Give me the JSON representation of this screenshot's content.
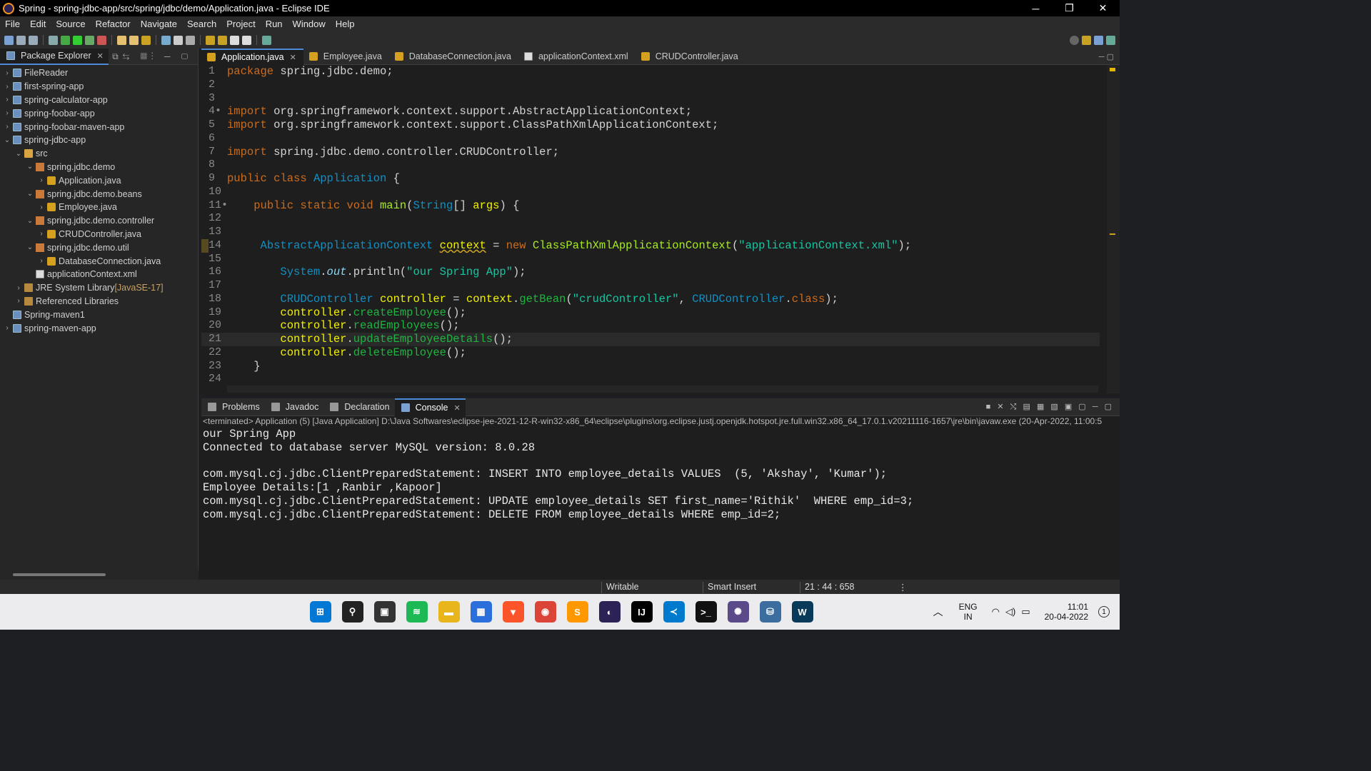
{
  "window": {
    "title": "Spring - spring-jdbc-app/src/spring/jdbc/demo/Application.java - Eclipse IDE",
    "minimize": "─",
    "restore": "❐",
    "close": "✕"
  },
  "menu": [
    "File",
    "Edit",
    "Source",
    "Refactor",
    "Navigate",
    "Search",
    "Project",
    "Run",
    "Window",
    "Help"
  ],
  "package_explorer": {
    "title": "Package Explorer",
    "items": [
      {
        "label": "FileReader",
        "icon": "project-icon",
        "indent": 0,
        "chevron": "›"
      },
      {
        "label": "first-spring-app",
        "icon": "project-icon",
        "indent": 0,
        "chevron": "›"
      },
      {
        "label": "spring-calculator-app",
        "icon": "project-icon",
        "indent": 0,
        "chevron": "›"
      },
      {
        "label": "spring-foobar-app",
        "icon": "project-icon",
        "indent": 0,
        "chevron": "›"
      },
      {
        "label": "spring-foobar-maven-app",
        "icon": "project-icon",
        "indent": 0,
        "chevron": "›"
      },
      {
        "label": "spring-jdbc-app",
        "icon": "project-icon",
        "indent": 0,
        "chevron": "⌄"
      },
      {
        "label": "src",
        "icon": "folder-icon",
        "indent": 1,
        "chevron": "⌄"
      },
      {
        "label": "spring.jdbc.demo",
        "icon": "package-icon",
        "indent": 2,
        "chevron": "⌄"
      },
      {
        "label": "Application.java",
        "icon": "java-file-icon",
        "indent": 3,
        "chevron": "›"
      },
      {
        "label": "spring.jdbc.demo.beans",
        "icon": "package-icon",
        "indent": 2,
        "chevron": "⌄"
      },
      {
        "label": "Employee.java",
        "icon": "java-file-icon",
        "indent": 3,
        "chevron": "›"
      },
      {
        "label": "spring.jdbc.demo.controller",
        "icon": "package-icon",
        "indent": 2,
        "chevron": "⌄"
      },
      {
        "label": "CRUDController.java",
        "icon": "java-file-icon",
        "indent": 3,
        "chevron": "›"
      },
      {
        "label": "spring.jdbc.demo.util",
        "icon": "package-icon",
        "indent": 2,
        "chevron": "⌄"
      },
      {
        "label": "DatabaseConnection.java",
        "icon": "java-file-icon",
        "indent": 3,
        "chevron": "›"
      },
      {
        "label": "applicationContext.xml",
        "icon": "xml-file-icon",
        "indent": 2,
        "chevron": ""
      },
      {
        "label": "JRE System Library",
        "suffix": "[JavaSE-17]",
        "icon": "library-icon",
        "indent": 1,
        "chevron": "›"
      },
      {
        "label": "Referenced Libraries",
        "icon": "library-icon",
        "indent": 1,
        "chevron": "›"
      },
      {
        "label": "Spring-maven1",
        "icon": "project-icon",
        "indent": 0,
        "chevron": ""
      },
      {
        "label": "spring-maven-app",
        "icon": "project-icon",
        "indent": 0,
        "chevron": "›"
      }
    ]
  },
  "editor_tabs": [
    {
      "label": "Application.java",
      "active": true
    },
    {
      "label": "Employee.java",
      "active": false
    },
    {
      "label": "DatabaseConnection.java",
      "active": false
    },
    {
      "label": "applicationContext.xml",
      "active": false
    },
    {
      "label": "CRUDController.java",
      "active": false
    }
  ],
  "code_lines": [
    {
      "n": "1",
      "html": "<span class='kw'>package</span> spring.jdbc.demo;"
    },
    {
      "n": "2",
      "html": ""
    },
    {
      "n": "3",
      "html": ""
    },
    {
      "n": "4",
      "html": "<span class='kw'>import</span> org.springframework.context.support.AbstractApplicationContext;",
      "marker": "•"
    },
    {
      "n": "5",
      "html": "<span class='kw'>import</span> org.springframework.context.support.ClassPathXmlApplicationContext;"
    },
    {
      "n": "6",
      "html": ""
    },
    {
      "n": "7",
      "html": "<span class='kw'>import</span> spring.jdbc.demo.controller.CRUDController;"
    },
    {
      "n": "8",
      "html": ""
    },
    {
      "n": "9",
      "html": "<span class='kw'>public</span> <span class='kw'>class</span> <span class='ty'>Application</span> {"
    },
    {
      "n": "10",
      "html": ""
    },
    {
      "n": "11",
      "html": "    <span class='kw'>public</span> <span class='kw'>static</span> <span class='kw'>void</span> <span class='fn'>main</span>(<span class='ty'>String</span>[] <span class='vr'>args</span>) {",
      "marker": "•"
    },
    {
      "n": "12",
      "html": ""
    },
    {
      "n": "13",
      "html": ""
    },
    {
      "n": "14",
      "html": "     <span class='ty'>AbstractApplicationContext</span> <span class='vr un'>context</span> = <span class='kw'>new</span> <span class='fn'>ClassPathXmlApplicationContext</span>(<span class='st'>\"applicationContext.xml\"</span>);",
      "warn": true
    },
    {
      "n": "15",
      "html": ""
    },
    {
      "n": "16",
      "html": "        <span class='ty'>System</span>.<span class='fld'>out</span>.println(<span class='st'>\"our Spring App\"</span>);"
    },
    {
      "n": "17",
      "html": ""
    },
    {
      "n": "18",
      "html": "        <span class='ty'>CRUDController</span> <span class='vr'>controller</span> = <span class='vr'>context</span>.<span class='mth'>getBean</span>(<span class='st'>\"crudController\"</span>, <span class='ty'>CRUDController</span>.<span class='kw'>class</span>);"
    },
    {
      "n": "19",
      "html": "        <span class='vr'>controller</span>.<span class='mth'>createEmployee</span>();"
    },
    {
      "n": "20",
      "html": "        <span class='vr'>controller</span>.<span class='mth'>readEmployees</span>();"
    },
    {
      "n": "21",
      "html": "        <span class='vr'>controller</span>.<span class='mth'>updateEmployeeDetails</span>();",
      "highlight": true
    },
    {
      "n": "22",
      "html": "        <span class='vr'>controller</span>.<span class='mth'>deleteEmployee</span>();"
    },
    {
      "n": "23",
      "html": "    }"
    },
    {
      "n": "24",
      "html": ""
    }
  ],
  "console": {
    "tabs": [
      {
        "label": "Problems",
        "icon": "problems-icon"
      },
      {
        "label": "Javadoc",
        "icon": "javadoc-icon"
      },
      {
        "label": "Declaration",
        "icon": "declaration-icon"
      },
      {
        "label": "Console",
        "icon": "console-icon",
        "active": true
      }
    ],
    "info": "<terminated> Application (5) [Java Application] D:\\Java Softwares\\eclipse-jee-2021-12-R-win32-x86_64\\eclipse\\plugins\\org.eclipse.justj.openjdk.hotspot.jre.full.win32.x86_64_17.0.1.v20211116-1657\\jre\\bin\\javaw.exe  (20-Apr-2022, 11:00:5",
    "output": [
      "our Spring App",
      "Connected to database server MySQL version: 8.0.28",
      "",
      "com.mysql.cj.jdbc.ClientPreparedStatement: INSERT INTO employee_details VALUES  (5, 'Akshay', 'Kumar');",
      "Employee Details:[1 ,Ranbir ,Kapoor]",
      "com.mysql.cj.jdbc.ClientPreparedStatement: UPDATE employee_details SET first_name='Rithik'  WHERE emp_id=3;",
      "com.mysql.cj.jdbc.ClientPreparedStatement: DELETE FROM employee_details WHERE emp_id=2;"
    ]
  },
  "status": {
    "writable": "Writable",
    "insert_mode": "Smart Insert",
    "position": "21 : 44 : 658",
    "more": "⋮"
  },
  "taskbar": {
    "apps": [
      {
        "name": "windows-start-icon",
        "glyph": "⊞",
        "color": "#0078d4"
      },
      {
        "name": "search-icon",
        "glyph": "⚲",
        "color": "#222"
      },
      {
        "name": "task-view-icon",
        "glyph": "▣",
        "color": "#333"
      },
      {
        "name": "spotify-icon",
        "glyph": "≋",
        "color": "#1db954"
      },
      {
        "name": "file-explorer-icon",
        "glyph": "▬",
        "color": "#e8b51a"
      },
      {
        "name": "microsoft-store-icon",
        "glyph": "▦",
        "color": "#2a6fdb"
      },
      {
        "name": "brave-icon",
        "glyph": "▼",
        "color": "#fb542b"
      },
      {
        "name": "chrome-icon",
        "glyph": "◉",
        "color": "#db4437"
      },
      {
        "name": "sublime-text-icon",
        "glyph": "S",
        "color": "#ff9800"
      },
      {
        "name": "eclipse-icon",
        "glyph": "◐",
        "color": "#2c2255"
      },
      {
        "name": "intellij-icon",
        "glyph": "IJ",
        "color": "#000"
      },
      {
        "name": "vscode-icon",
        "glyph": "≺",
        "color": "#007acc"
      },
      {
        "name": "terminal-icon",
        "glyph": ">_",
        "color": "#111"
      },
      {
        "name": "eclipse-ide-icon",
        "glyph": "✺",
        "color": "#5b4a8a"
      },
      {
        "name": "mysql-workbench-icon",
        "glyph": "⛁",
        "color": "#3b6e9f"
      },
      {
        "name": "wave-app-icon",
        "glyph": "W",
        "color": "#0a3a5a"
      }
    ],
    "lang_line1": "ENG",
    "lang_line2": "IN",
    "time": "11:01",
    "date": "20-04-2022",
    "notifications": "1",
    "show-hidden": "︿"
  }
}
